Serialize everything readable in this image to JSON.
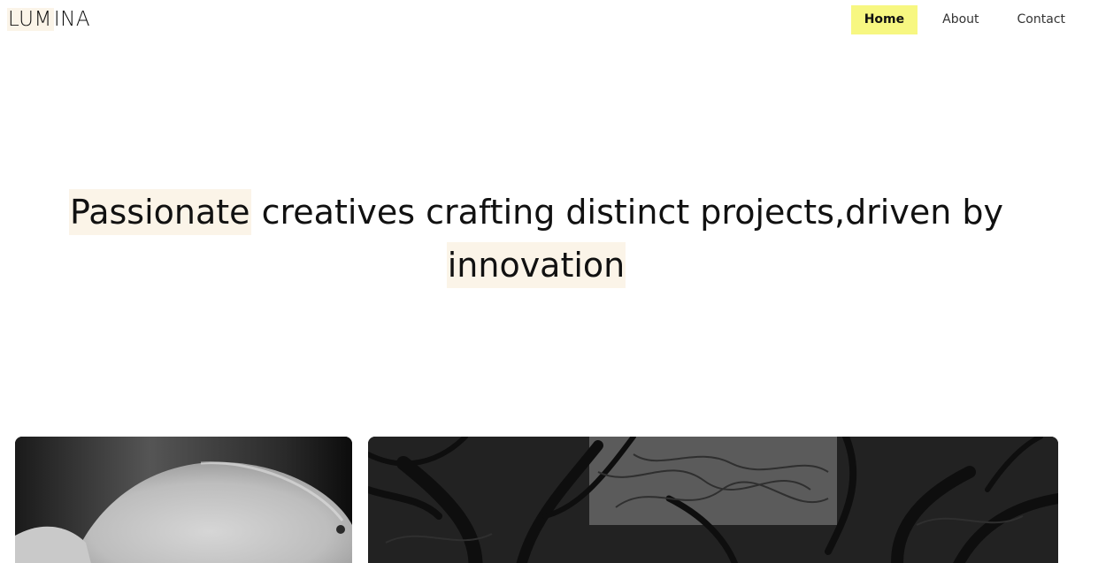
{
  "brand": {
    "logo_highlight": "LUM",
    "logo_rest": "INA"
  },
  "nav": {
    "items": [
      {
        "label": "Home",
        "active": true
      },
      {
        "label": "About",
        "active": false
      },
      {
        "label": "Contact",
        "active": false
      }
    ]
  },
  "hero": {
    "word_1": "Passionate",
    "middle": " creatives crafting distinct projects,driven by ",
    "word_2": "innovation"
  },
  "gallery": {
    "images": [
      {
        "subject": "mushroom-cap-closeup",
        "tone": "grayscale"
      },
      {
        "subject": "twisted-tree-branches",
        "tone": "grayscale"
      }
    ]
  },
  "colors": {
    "nav_active_bg": "#f7f781",
    "text_highlight": "#fbf4e8",
    "text": "#111111"
  }
}
